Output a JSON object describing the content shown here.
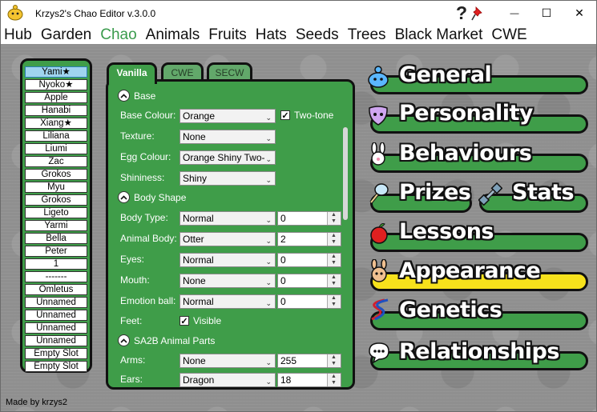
{
  "window": {
    "title": "Krzys2's Chao Editor v.3.0.0",
    "help_glyph": "?",
    "minimize_glyph": "—",
    "maximize_glyph": "☐",
    "close_glyph": "✕"
  },
  "menu": [
    "Hub",
    "Garden",
    "Chao",
    "Animals",
    "Fruits",
    "Hats",
    "Seeds",
    "Trees",
    "Black Market",
    "CWE"
  ],
  "chao_list": [
    "Yami★",
    "Nyoko★",
    "Apple",
    "Hanabi",
    "Xiang★",
    "Liliana",
    "Liumi",
    "Zac",
    "Grokos",
    "Myu",
    "Grokos",
    "Ligeto",
    "Yarmi",
    "Bella",
    "Peter",
    "1",
    "-------",
    "Omletus",
    "Unnamed",
    "Unnamed",
    "Unnamed",
    "Unnamed",
    "Empty Slot",
    "Empty Slot"
  ],
  "editor": {
    "tabs": [
      "Vanilla",
      "CWE",
      "SECW"
    ],
    "sections": {
      "base": "Base",
      "body_shape": "Body Shape",
      "sa2b": "SA2B Animal Parts"
    },
    "fields": {
      "base_colour": {
        "label": "Base Colour:",
        "value": "Orange"
      },
      "two_tone": {
        "label": "Two-tone",
        "checked": true
      },
      "texture": {
        "label": "Texture:",
        "value": "None"
      },
      "egg_colour": {
        "label": "Egg Colour:",
        "value": "Orange Shiny Two-"
      },
      "shininess": {
        "label": "Shininess:",
        "value": "Shiny"
      },
      "body_type": {
        "label": "Body Type:",
        "value": "Normal",
        "num": "0"
      },
      "animal_body": {
        "label": "Animal Body:",
        "value": "Otter",
        "num": "2"
      },
      "eyes": {
        "label": "Eyes:",
        "value": "Normal",
        "num": "0"
      },
      "mouth": {
        "label": "Mouth:",
        "value": "None",
        "num": "0"
      },
      "emotion_ball": {
        "label": "Emotion ball:",
        "value": "Normal",
        "num": "0"
      },
      "feet": {
        "label": "Feet:",
        "visible_label": "Visible",
        "checked": true
      },
      "arms": {
        "label": "Arms:",
        "value": "None",
        "num": "255"
      },
      "ears": {
        "label": "Ears:",
        "value": "Dragon",
        "num": "18"
      }
    }
  },
  "nav": [
    "General",
    "Personality",
    "Behaviours",
    "Prizes",
    "Stats",
    "Lessons",
    "Appearance",
    "Genetics",
    "Relationships"
  ],
  "nav_active": "Appearance",
  "footer": "Made by krzys2",
  "colors": {
    "panel_green": "#3f9d49",
    "active_menu": "#3a9b4c",
    "active_nav": "#f7e21c",
    "selected_list": "#9fd4ef"
  }
}
